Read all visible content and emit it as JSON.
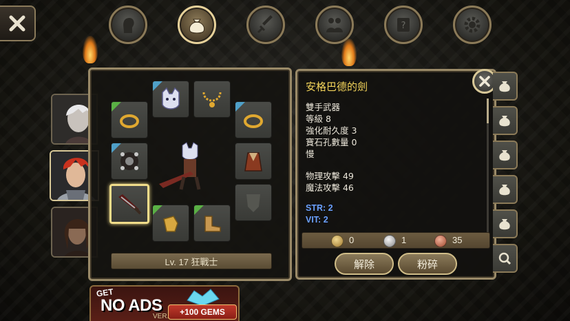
{
  "top_tabs": [
    {
      "name": "tab-character",
      "icon": "head-icon",
      "active": false
    },
    {
      "name": "tab-inventory",
      "icon": "bag-icon",
      "active": true
    },
    {
      "name": "tab-skills",
      "icon": "sword-icon",
      "active": false
    },
    {
      "name": "tab-party",
      "icon": "people-icon",
      "active": false
    },
    {
      "name": "tab-quests",
      "icon": "scroll-icon",
      "active": false
    },
    {
      "name": "tab-settings",
      "icon": "gear-icon",
      "active": false
    }
  ],
  "equipment": {
    "level_label": "Lv. 17 狂戰士"
  },
  "item_detail": {
    "name": "安格巴德的劍",
    "stats": [
      "雙手武器",
      "等級 8",
      "強化耐久度 3",
      "寶石孔數量 0",
      "慢"
    ],
    "attack": [
      "物理攻擊 49",
      "魔法攻擊 46"
    ],
    "attributes": [
      "STR: 2",
      "VIT: 2"
    ],
    "currency": {
      "gold": "0",
      "silver": "1",
      "copper": "35"
    },
    "buttons": {
      "unequip": "解除",
      "shatter": "粉碎"
    }
  },
  "ad": {
    "get": "GET",
    "no_ads": "NO ADS",
    "ver": "VER.",
    "gems": "+100 GEMS"
  },
  "colors": {
    "title_gold": "#f2d35a",
    "attr_blue": "#6aa0ff",
    "frame": "#9a8a68"
  }
}
